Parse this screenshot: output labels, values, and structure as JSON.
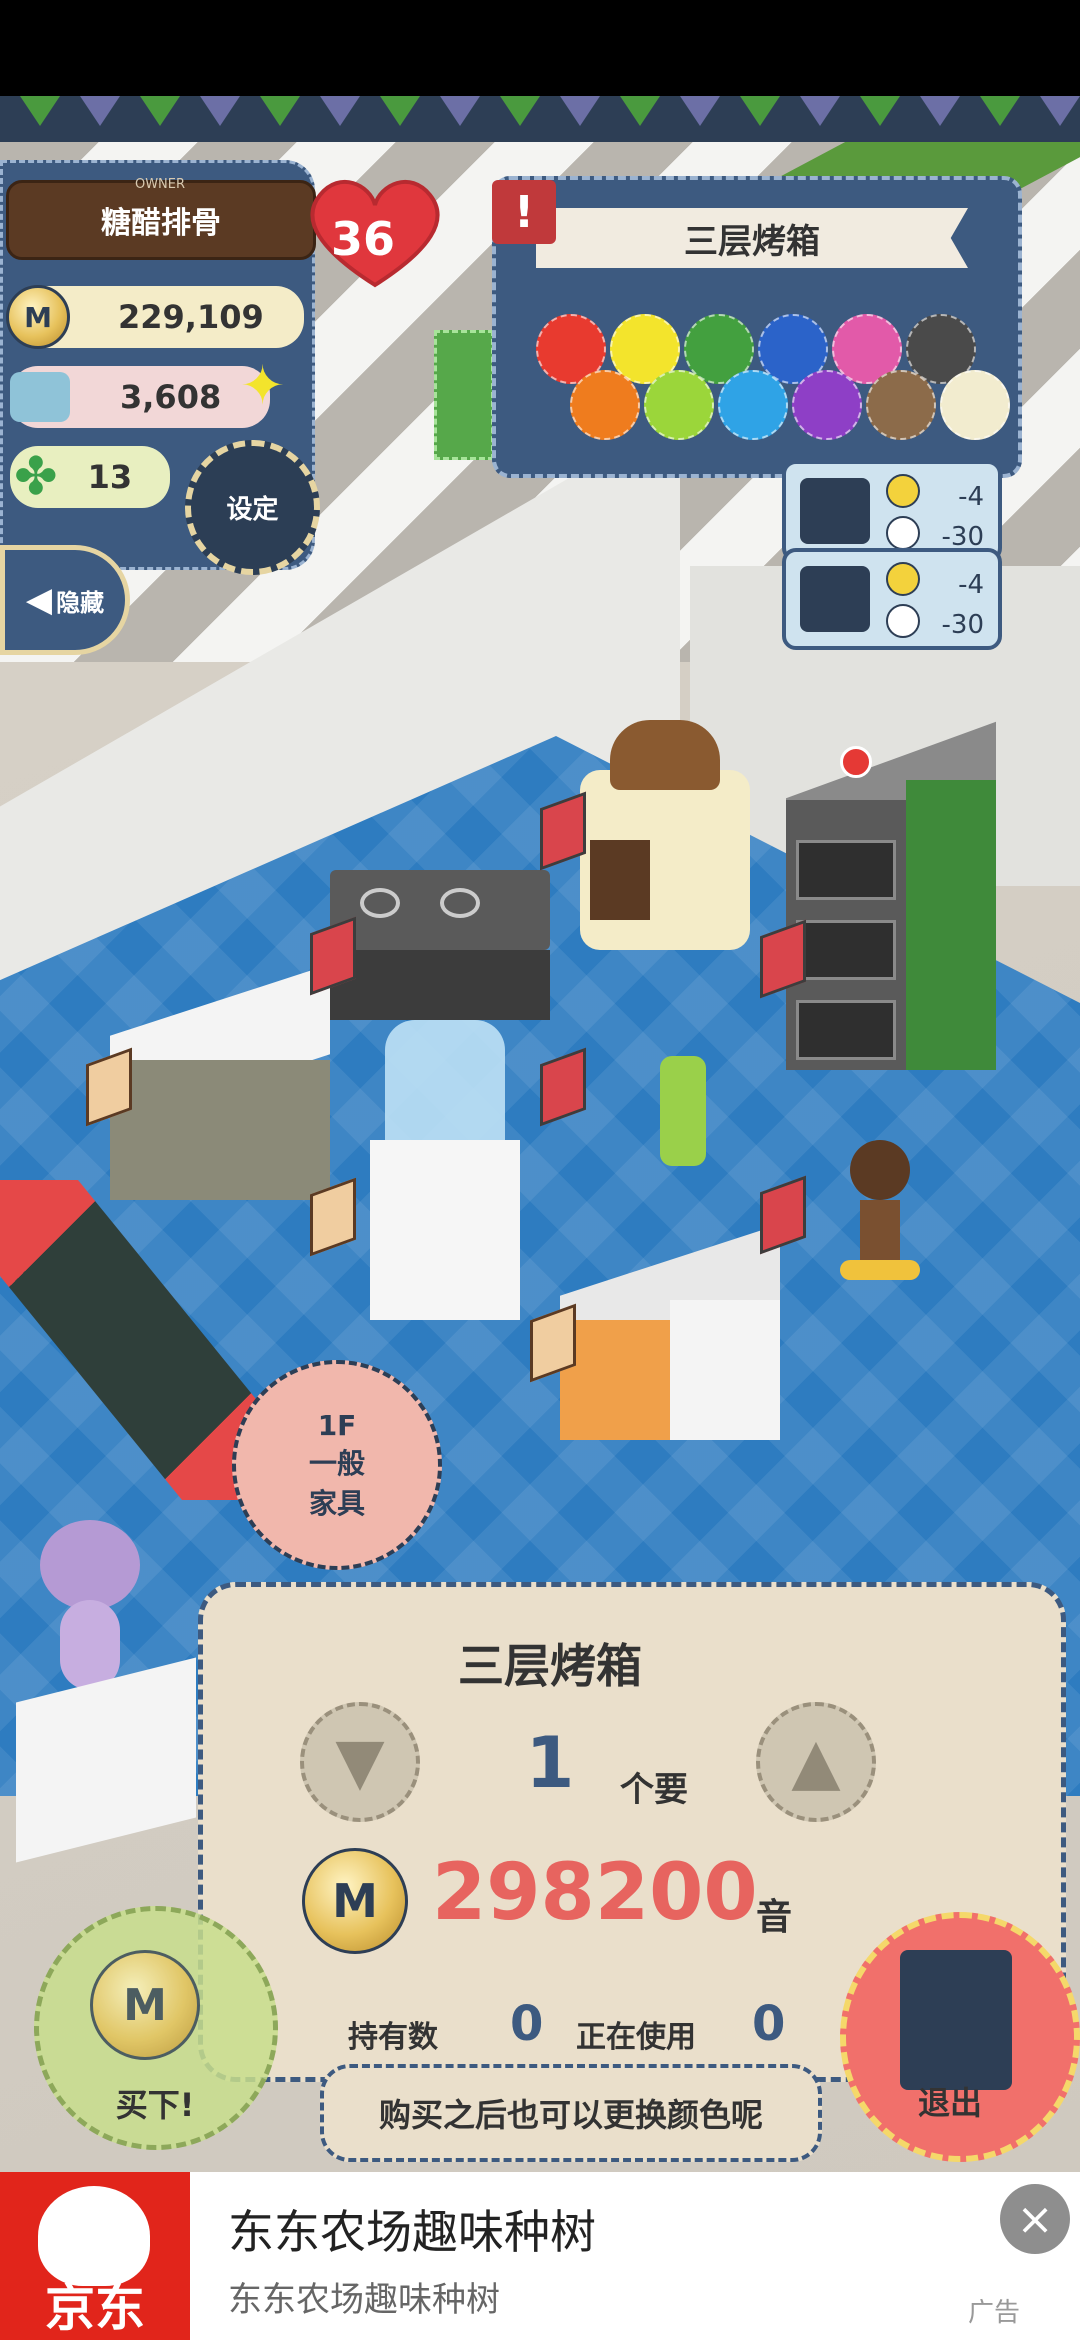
{
  "owner": {
    "small_label": "OWNER",
    "name": "糖醋排骨",
    "level": "36",
    "coins": "229,109",
    "items": "3,608",
    "clovers": "13",
    "settings_label": "设定",
    "hide_label": "隐藏"
  },
  "color_panel": {
    "title": "三层烤箱",
    "alert": "!",
    "swatches": [
      "#e83a2f",
      "#f3e42c",
      "#43a03f",
      "#2b63c9",
      "#e25aa9",
      "#4a4a4a",
      "#ef7c1e",
      "#9bd63a",
      "#2fa3e6",
      "#8e3fc6",
      "#8c6b4a",
      "#f2eccf"
    ]
  },
  "effects": [
    {
      "icon": "microwave-icon",
      "mood": "-4",
      "time": "-30"
    },
    {
      "icon": "toaster-icon",
      "mood": "-4",
      "time": "-30"
    }
  ],
  "floor_bubble": {
    "floor": "1F",
    "line2": "一般",
    "line3": "家具"
  },
  "purchase": {
    "title": "三层烤箱",
    "quantity": "1",
    "quantity_unit": "个要",
    "coin_symbol": "M",
    "price": "298200",
    "price_unit": "音",
    "owned_label": "持有数",
    "owned_value": "0",
    "in_use_label": "正在使用",
    "in_use_value": "0",
    "tip": "购买之后也可以更换颜色呢"
  },
  "buttons": {
    "buy": "买下!",
    "exit": "退出"
  },
  "ad": {
    "brand": "京东",
    "title": "东东农场趣味种树",
    "subtitle": "东东农场趣味种树",
    "tag": "广告",
    "close": "×"
  }
}
